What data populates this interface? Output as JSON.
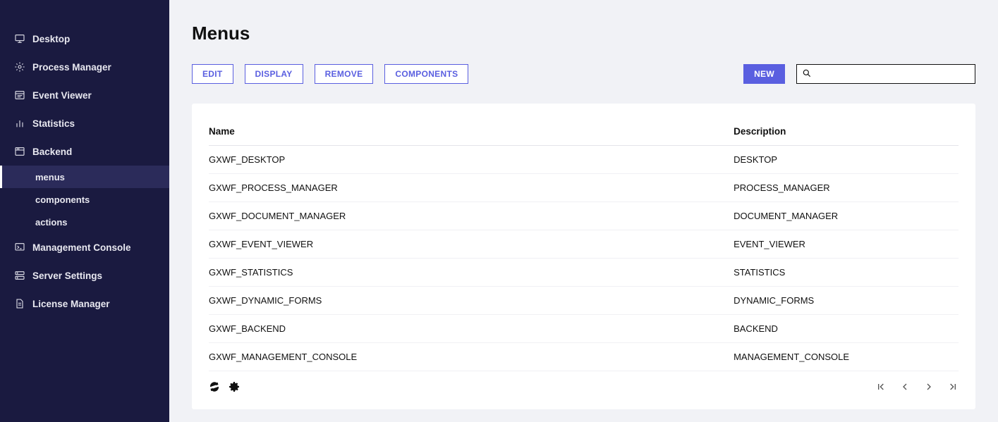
{
  "sidebar": {
    "items": [
      {
        "label": "Desktop",
        "icon": "monitor"
      },
      {
        "label": "Process Manager",
        "icon": "gear-dots"
      },
      {
        "label": "Event Viewer",
        "icon": "window-list"
      },
      {
        "label": "Statistics",
        "icon": "barchart"
      },
      {
        "label": "Backend",
        "icon": "app-window",
        "children": [
          {
            "label": "menus",
            "active": true
          },
          {
            "label": "components"
          },
          {
            "label": "actions"
          }
        ]
      },
      {
        "label": "Management Console",
        "icon": "console"
      },
      {
        "label": "Server Settings",
        "icon": "server-gear"
      },
      {
        "label": "License Manager",
        "icon": "document"
      }
    ]
  },
  "page": {
    "title": "Menus"
  },
  "toolbar": {
    "edit": "EDIT",
    "display": "DISPLAY",
    "remove": "REMOVE",
    "components": "COMPONENTS",
    "new": "NEW"
  },
  "search": {
    "placeholder": ""
  },
  "table": {
    "col_name": "Name",
    "col_desc": "Description",
    "rows": [
      {
        "name": "GXWF_DESKTOP",
        "desc": "DESKTOP"
      },
      {
        "name": "GXWF_PROCESS_MANAGER",
        "desc": "PROCESS_MANAGER"
      },
      {
        "name": "GXWF_DOCUMENT_MANAGER",
        "desc": "DOCUMENT_MANAGER"
      },
      {
        "name": "GXWF_EVENT_VIEWER",
        "desc": "EVENT_VIEWER"
      },
      {
        "name": "GXWF_STATISTICS",
        "desc": "STATISTICS"
      },
      {
        "name": "GXWF_DYNAMIC_FORMS",
        "desc": "DYNAMIC_FORMS"
      },
      {
        "name": "GXWF_BACKEND",
        "desc": "BACKEND"
      },
      {
        "name": "GXWF_MANAGEMENT_CONSOLE",
        "desc": "MANAGEMENT_CONSOLE"
      }
    ]
  }
}
